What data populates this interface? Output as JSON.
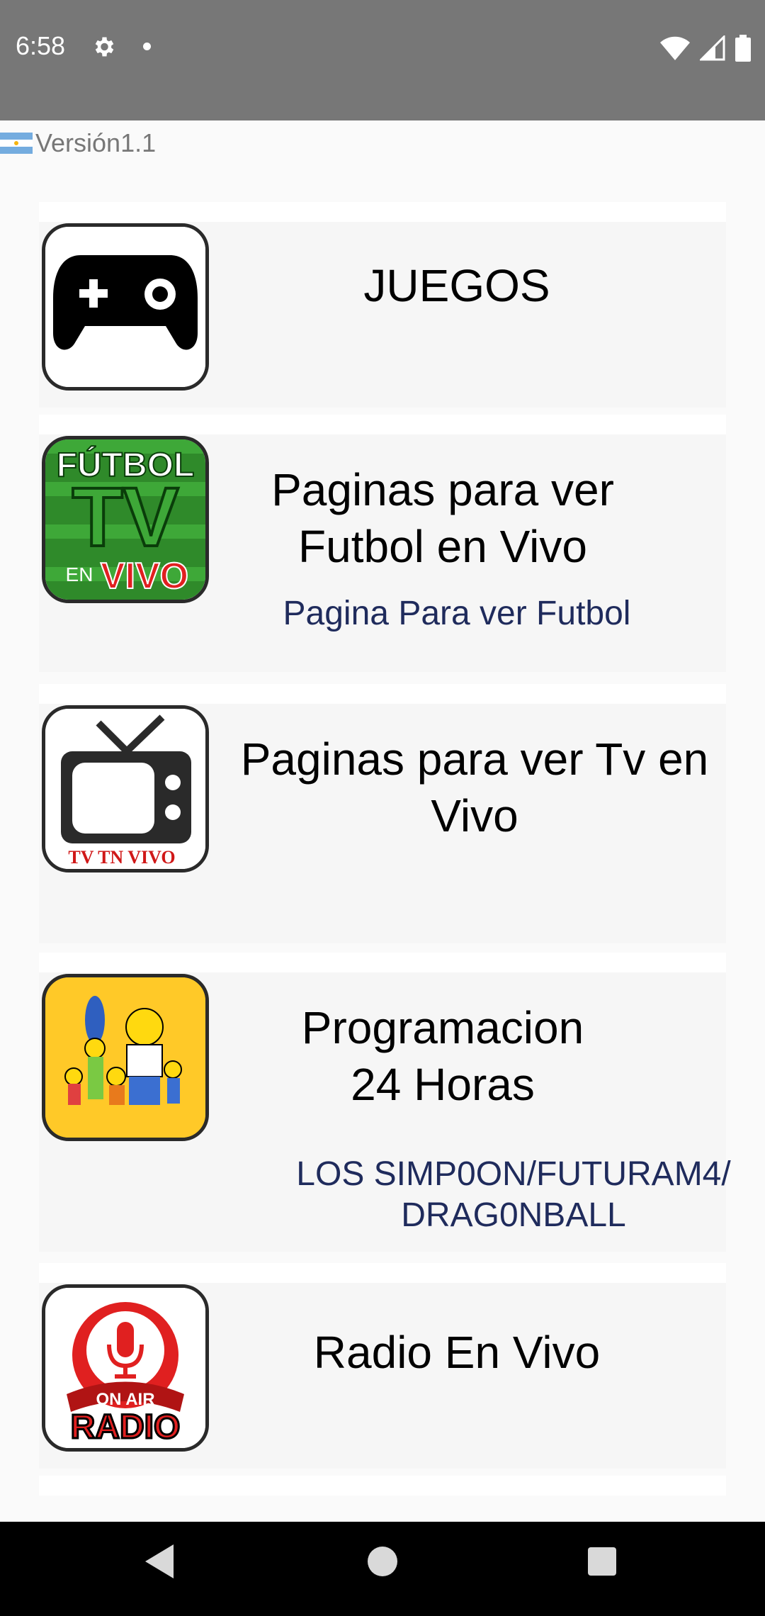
{
  "status_bar": {
    "time": "6:58",
    "background": "#777777",
    "icons": [
      "gear-icon",
      "notification-dot-icon",
      "wifi-icon",
      "cell-signal-icon",
      "battery-icon"
    ]
  },
  "header": {
    "flag_icon": "argentina-flag-icon",
    "version_text": "Versión1.1"
  },
  "items": [
    {
      "title": "JUEGOS",
      "subtitle": "",
      "icon": "gamepad-icon"
    },
    {
      "title": "Paginas para ver Futbol en Vivo",
      "subtitle": "Pagina Para ver Futbol",
      "icon": "futbol-tv-icon",
      "icon_text": [
        "FÚTBOL",
        "TV",
        "EN",
        "VIVO"
      ]
    },
    {
      "title": "Paginas para ver Tv en Vivo",
      "subtitle": "",
      "icon": "tv-icon",
      "icon_text": [
        "TV TN VIVO"
      ]
    },
    {
      "title": "Programacion 24 Horas",
      "subtitle": "LOS SIMP0ON/FUTURAM4/ DRAG0NBALL",
      "icon": "cartoon-family-icon"
    },
    {
      "title": "Radio En Vivo",
      "subtitle": "",
      "icon": "radio-icon",
      "icon_text": [
        "ON AIR",
        "RADIO"
      ]
    }
  ],
  "navigation": {
    "buttons": [
      "back-icon",
      "home-icon",
      "recents-icon"
    ]
  },
  "colors": {
    "subtitle": "#1f2b5c",
    "accent_red": "#e02020",
    "football_green": "#2f8a2a",
    "cartoon_yellow": "#ffc928"
  }
}
